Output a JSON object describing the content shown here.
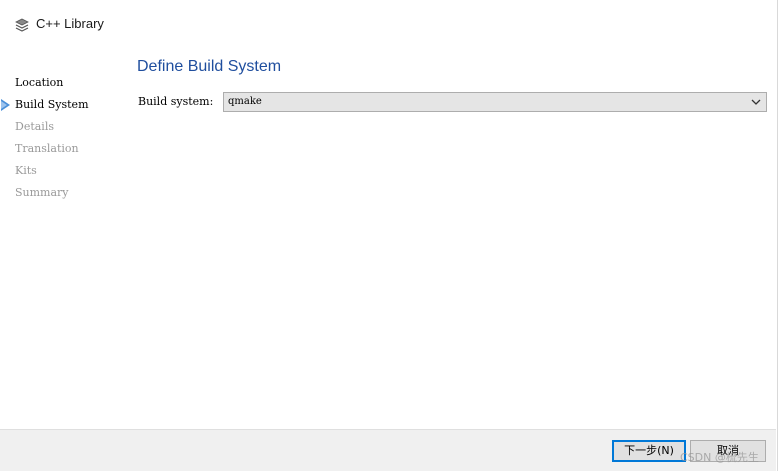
{
  "window": {
    "title": "C++ Library",
    "icon": "stacked-layers-icon"
  },
  "steps": [
    {
      "label": "Location",
      "state": "done"
    },
    {
      "label": "Build System",
      "state": "active"
    },
    {
      "label": "Details",
      "state": "pending"
    },
    {
      "label": "Translation",
      "state": "pending"
    },
    {
      "label": "Kits",
      "state": "pending"
    },
    {
      "label": "Summary",
      "state": "pending"
    }
  ],
  "page": {
    "title": "Define Build System",
    "build_system_label": "Build system:",
    "build_system_value": "qmake"
  },
  "buttons": {
    "next_label": "下一步(N)",
    "cancel_label": "取消"
  },
  "watermark": "CSDN @梳先生",
  "colors": {
    "accent_title": "#1f4e9e",
    "pending_step": "#9a9a9a",
    "active_arrow": "#4a8fd8",
    "default_button_border": "#0078d7"
  }
}
